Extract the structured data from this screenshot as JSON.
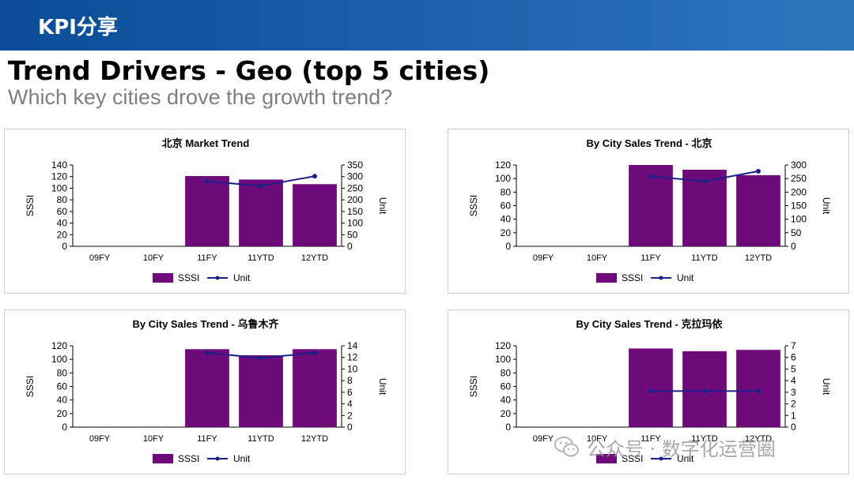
{
  "header": {
    "title": "KPI分享"
  },
  "slide": {
    "title": "Trend Drivers - Geo (top 5 cities)",
    "subtitle": "Which key cities drove the growth trend?"
  },
  "watermark": {
    "text": "公众号 · 数字化运营圈",
    "icon": "wechat-icon"
  },
  "colors": {
    "bar": "#6f0a7b",
    "line": "#1c1f8a",
    "banner": "#1a5fa9"
  },
  "chart_data": [
    {
      "type": "bar+line",
      "title": "北京 Market Trend",
      "categories": [
        "09FY",
        "10FY",
        "11FY",
        "11YTD",
        "12YTD"
      ],
      "ylabel": "SSSI",
      "y2label": "Unit",
      "ylim": [
        0,
        140
      ],
      "yticks": [
        0,
        20,
        40,
        60,
        80,
        100,
        120,
        140
      ],
      "y2lim": [
        0,
        350
      ],
      "y2ticks": [
        0,
        50,
        100,
        150,
        200,
        250,
        300,
        350
      ],
      "series": [
        {
          "name": "SSSI",
          "kind": "bar",
          "axis": "left",
          "values": [
            null,
            null,
            121,
            115,
            107
          ]
        },
        {
          "name": "Unit",
          "kind": "line",
          "axis": "right",
          "values": [
            null,
            null,
            280,
            260,
            302
          ]
        }
      ],
      "legend": "bottom"
    },
    {
      "type": "bar+line",
      "title": "By City Sales Trend - 北京",
      "categories": [
        "09FY",
        "10FY",
        "11FY",
        "11YTD",
        "12YTD"
      ],
      "ylabel": "SSSI",
      "y2label": "Unit",
      "ylim": [
        0,
        120
      ],
      "yticks": [
        0,
        20,
        40,
        60,
        80,
        100,
        120
      ],
      "y2lim": [
        0,
        300
      ],
      "y2ticks": [
        0,
        50,
        100,
        150,
        200,
        250,
        300
      ],
      "series": [
        {
          "name": "SSSI",
          "kind": "bar",
          "axis": "left",
          "values": [
            null,
            null,
            120,
            113,
            105
          ]
        },
        {
          "name": "Unit",
          "kind": "line",
          "axis": "right",
          "values": [
            null,
            null,
            258,
            240,
            277
          ]
        }
      ],
      "legend": "bottom"
    },
    {
      "type": "bar+line",
      "title": "By City Sales Trend - 乌鲁木齐",
      "categories": [
        "09FY",
        "10FY",
        "11FY",
        "11YTD",
        "12YTD"
      ],
      "ylabel": "SSSI",
      "y2label": "Unit",
      "ylim": [
        0,
        120
      ],
      "yticks": [
        0,
        20,
        40,
        60,
        80,
        100,
        120
      ],
      "y2lim": [
        0,
        14
      ],
      "y2ticks": [
        0,
        2,
        4,
        6,
        8,
        10,
        12,
        14
      ],
      "series": [
        {
          "name": "SSSI",
          "kind": "bar",
          "axis": "left",
          "values": [
            null,
            null,
            115,
            106,
            115
          ]
        },
        {
          "name": "Unit",
          "kind": "line",
          "axis": "right",
          "values": [
            null,
            null,
            12.8,
            11.9,
            12.8
          ]
        }
      ],
      "legend": "bottom"
    },
    {
      "type": "bar+line",
      "title": "By City Sales Trend - 克拉玛依",
      "categories": [
        "09FY",
        "10FY",
        "11FY",
        "11YTD",
        "12YTD"
      ],
      "ylabel": "SSSI",
      "y2label": "Unit",
      "ylim": [
        0,
        120
      ],
      "yticks": [
        0,
        20,
        40,
        60,
        80,
        100,
        120
      ],
      "y2lim": [
        0,
        7
      ],
      "y2ticks": [
        0,
        1,
        2,
        3,
        4,
        5,
        6,
        7
      ],
      "series": [
        {
          "name": "SSSI",
          "kind": "bar",
          "axis": "left",
          "values": [
            null,
            null,
            116,
            112,
            114
          ]
        },
        {
          "name": "Unit",
          "kind": "line",
          "axis": "right",
          "values": [
            null,
            null,
            3.1,
            3.1,
            3.1
          ]
        }
      ],
      "legend": "bottom"
    }
  ]
}
